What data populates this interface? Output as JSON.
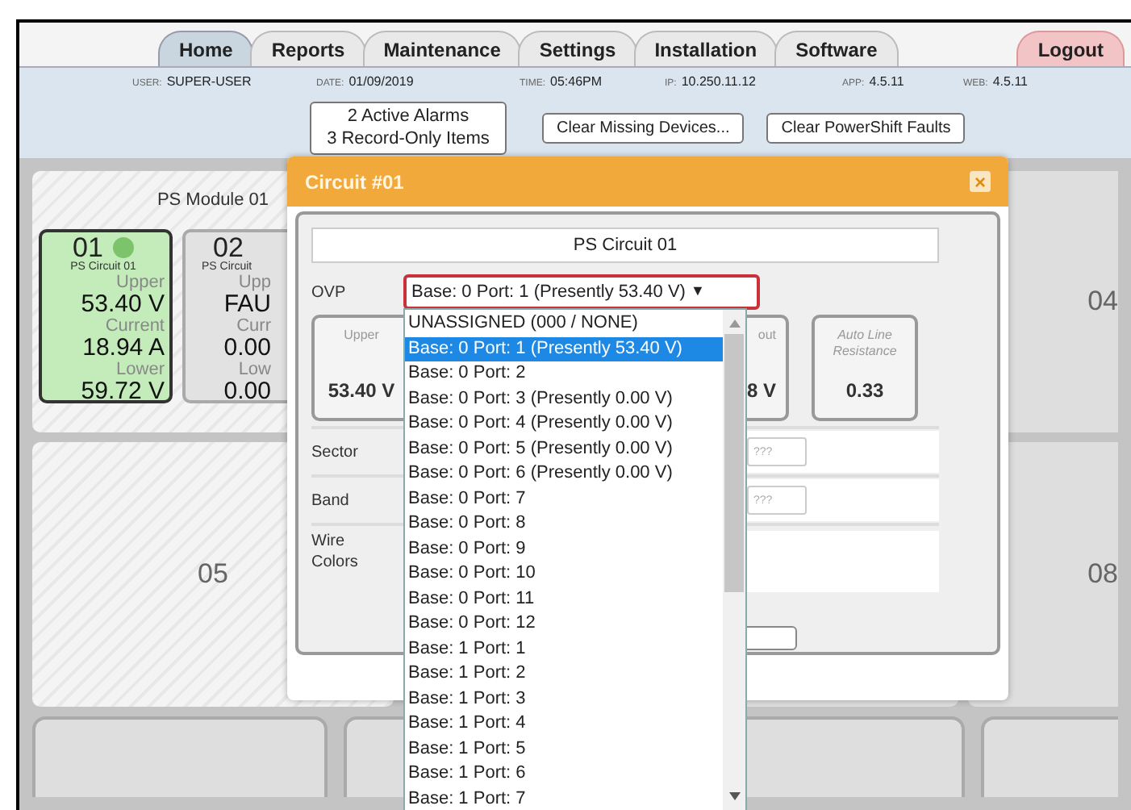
{
  "tabs": [
    {
      "label": "Home",
      "selected": true,
      "kind": "nav"
    },
    {
      "label": "Reports",
      "selected": false,
      "kind": "nav"
    },
    {
      "label": "Maintenance",
      "selected": false,
      "kind": "nav"
    },
    {
      "label": "Settings",
      "selected": false,
      "kind": "nav"
    },
    {
      "label": "Installation",
      "selected": false,
      "kind": "nav"
    },
    {
      "label": "Software",
      "selected": false,
      "kind": "nav"
    },
    {
      "label": "Logout",
      "selected": false,
      "kind": "logout"
    }
  ],
  "info": [
    {
      "label": "USER:",
      "value": "SUPER-USER"
    },
    {
      "label": "DATE:",
      "value": "01/09/2019"
    },
    {
      "label": "TIME:",
      "value": "05:46PM"
    },
    {
      "label": "IP:",
      "value": "10.250.11.12"
    },
    {
      "label": "APP:",
      "value": "4.5.11"
    },
    {
      "label": "WEB:",
      "value": "4.5.11"
    }
  ],
  "alarms": [
    "2 Active Alarms",
    "3 Record-Only Items"
  ],
  "buttons": [
    "Clear Missing Devices...",
    "Clear PowerShift Faults"
  ],
  "module": {
    "title": "PS Module 01",
    "circuits": [
      {
        "number": "01",
        "name": "PS Circuit 01",
        "selected": true,
        "color": "#7dc36b",
        "upper_label": "Upper",
        "upper": "53.40 V",
        "current_label": "Current",
        "current": "18.94 A",
        "lower_label": "Lower",
        "lower": "59.72 V"
      },
      {
        "number": "02",
        "name": "PS Circuit",
        "selected": false,
        "upper_label": "Upp",
        "upper": "FAU",
        "current_label": "Curr",
        "current": "0.00",
        "lower_label": "Low",
        "lower": "0.00"
      }
    ]
  },
  "panels": [
    "04",
    "05",
    "08"
  ],
  "dialog": {
    "title": "Circuit #01",
    "close": "×",
    "name": "PS Circuit 01",
    "ovp_label": "OVP",
    "ovp_value": "Base: 0 Port: 1 (Presently 53.40 V)",
    "ovp_caret": "▼",
    "boxes": [
      {
        "label": "Upper",
        "value": "53.40 V",
        "kind": "plain"
      },
      {
        "label": "out",
        "value": "8 V",
        "kind": "plain"
      },
      {
        "label": "Auto Line Resistance",
        "value": "0.33",
        "kind": "italic"
      }
    ],
    "sector_label": "Sector",
    "sector_placeholder": "???",
    "band_label": "Band",
    "band_placeholder": "???",
    "wire_label": "Wire Colors",
    "options": [
      {
        "label": "UNASSIGNED (000 / NONE)",
        "selected": false
      },
      {
        "label": "Base: 0 Port: 1 (Presently 53.40 V)",
        "selected": true
      },
      {
        "label": "Base: 0 Port: 2",
        "selected": false
      },
      {
        "label": "Base: 0 Port: 3 (Presently 0.00 V)",
        "selected": false
      },
      {
        "label": "Base: 0 Port: 4 (Presently 0.00 V)",
        "selected": false
      },
      {
        "label": "Base: 0 Port: 5 (Presently 0.00 V)",
        "selected": false
      },
      {
        "label": "Base: 0 Port: 6 (Presently 0.00 V)",
        "selected": false
      },
      {
        "label": "Base: 0 Port: 7",
        "selected": false
      },
      {
        "label": "Base: 0 Port: 8",
        "selected": false
      },
      {
        "label": "Base: 0 Port: 9",
        "selected": false
      },
      {
        "label": "Base: 0 Port: 10",
        "selected": false
      },
      {
        "label": "Base: 0 Port: 11",
        "selected": false
      },
      {
        "label": "Base: 0 Port: 12",
        "selected": false
      },
      {
        "label": "Base: 1 Port: 1",
        "selected": false
      },
      {
        "label": "Base: 1 Port: 2",
        "selected": false
      },
      {
        "label": "Base: 1 Port: 3",
        "selected": false
      },
      {
        "label": "Base: 1 Port: 4",
        "selected": false
      },
      {
        "label": "Base: 1 Port: 5",
        "selected": false
      },
      {
        "label": "Base: 1 Port: 6",
        "selected": false
      },
      {
        "label": "Base: 1 Port: 7",
        "selected": false
      }
    ]
  }
}
